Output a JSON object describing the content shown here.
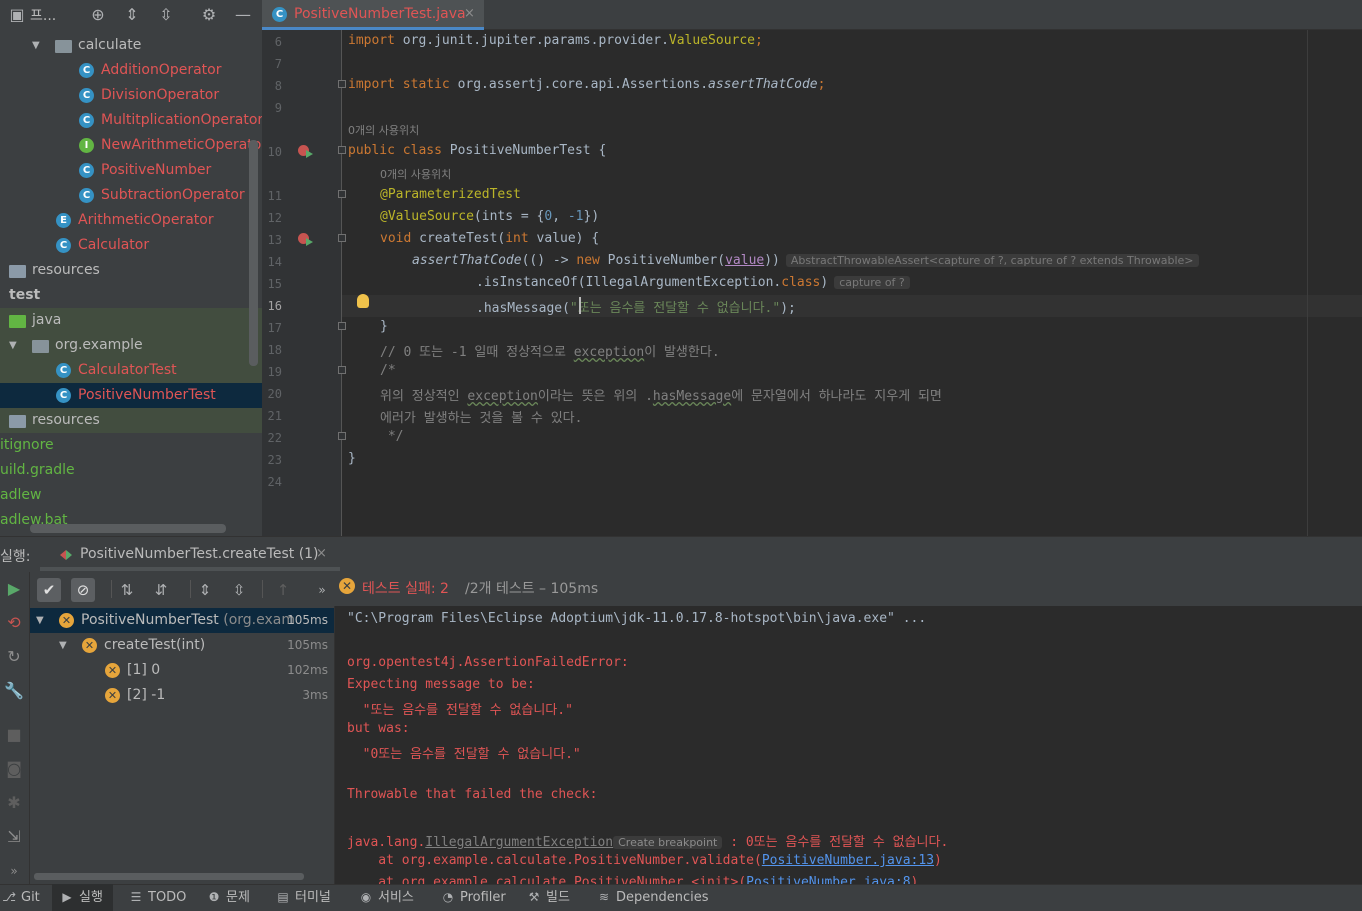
{
  "project": {
    "title": "프...",
    "tree": [
      {
        "label": "calculate",
        "kind": "package",
        "expanded": true,
        "color": "plain"
      },
      {
        "label": "AdditionOperator",
        "kind": "class",
        "color": "red"
      },
      {
        "label": "DivisionOperator",
        "kind": "class",
        "color": "red"
      },
      {
        "label": "MultitplicationOperator",
        "kind": "class",
        "color": "red"
      },
      {
        "label": "NewArithmeticOperator",
        "kind": "interface",
        "color": "red"
      },
      {
        "label": "PositiveNumber",
        "kind": "class",
        "color": "red"
      },
      {
        "label": "SubtractionOperator",
        "kind": "class",
        "color": "red"
      },
      {
        "label": "ArithmeticOperator",
        "kind": "enum",
        "color": "red"
      },
      {
        "label": "Calculator",
        "kind": "class",
        "color": "red"
      },
      {
        "label": "resources",
        "kind": "folder",
        "color": "plain"
      },
      {
        "label": "test",
        "kind": "folder",
        "color": "bold"
      },
      {
        "label": "java",
        "kind": "folder",
        "color": "plain"
      },
      {
        "label": "org.example",
        "kind": "package",
        "expanded": true,
        "color": "plain"
      },
      {
        "label": "CalculatorTest",
        "kind": "test-class",
        "color": "red"
      },
      {
        "label": "PositiveNumberTest",
        "kind": "test-class",
        "color": "red",
        "selected": true
      },
      {
        "label": "resources",
        "kind": "folder",
        "color": "plain"
      },
      {
        "label": "itignore",
        "kind": "file",
        "color": "green"
      },
      {
        "label": "uild.gradle",
        "kind": "file",
        "color": "green"
      },
      {
        "label": "adlew",
        "kind": "file",
        "color": "green"
      },
      {
        "label": "adlew.bat",
        "kind": "file",
        "color": "green"
      }
    ]
  },
  "editor": {
    "tab_label": "PositiveNumberTest.java",
    "tab_close": "×",
    "line_numbers": [
      "6",
      "7",
      "8",
      "9",
      "10",
      "11",
      "12",
      "13",
      "14",
      "15",
      "16",
      "17",
      "18",
      "19",
      "20",
      "21",
      "22",
      "23",
      "24"
    ],
    "usage_hint_1": "0개의 사용위치",
    "usage_hint_2": "0개의 사용위치",
    "code": {
      "l6_kw": "import",
      "l6_rest": " org.junit.jupiter.params.provider.",
      "l6_ann": "ValueSource",
      "l6_end": ";",
      "l8_kw": "import static",
      "l8_rest": " org.assertj.core.api.Assertions.",
      "l8_method": "assertThatCode",
      "l8_end": ";",
      "l10_kw": "public class",
      "l10_rest": " PositiveNumberTest {",
      "l11_ann": "@ParameterizedTest",
      "l12_ann": "@ValueSource",
      "l12_a": "(ints = {",
      "l12_n1": "0",
      "l12_b": ", ",
      "l12_n2": "-1",
      "l12_c": "})",
      "l13_kw": "void",
      "l13_a": " createTest(",
      "l13_kw2": "int",
      "l13_b": " value) {",
      "l14_method": "assertThatCode",
      "l14_a": "(() -> ",
      "l14_kw": "new",
      "l14_b": " PositiveNumber(",
      "l14_param": "value",
      "l14_c": "))",
      "l14_hint": "AbstractThrowableAssert<capture of ?, capture of ? extends Throwable>",
      "l15_a": ".isInstanceOf(IllegalArgumentException.",
      "l15_kw": "class",
      "l15_b": ")",
      "l15_hint": "capture of ?",
      "l16_a": ".hasMessage(",
      "l16_str": "\"또는 음수를 전달할 수 없습니다.\"",
      "l16_b": ");",
      "l17": "}",
      "l18_a": "// 0 또는 -1 일때 정상적으로 ",
      "l18_typo": "exception",
      "l18_b": "이 발생한다.",
      "l19": "/*",
      "l20_a": "위의 정상적인 ",
      "l20_typo1": "exception",
      "l20_b": "이라는 뜻은 위의 .",
      "l20_typo2": "hasMessage",
      "l20_c": "에 문자열에서 하나라도 지우게 되면",
      "l21": "에러가 발생하는 것을 볼 수 있다.",
      "l22": " */",
      "l23": "}"
    }
  },
  "run": {
    "title": "실행:",
    "tab_label": "PositiveNumberTest.createTest (1)",
    "tab_close": "×",
    "status_fail": "테스트 실패: 2",
    "status_rest": "/2개 테스트 – 105ms",
    "tree": [
      {
        "name": "PositiveNumberTest",
        "pkg": " (org.exam",
        "time": "105ms"
      },
      {
        "name": "createTest(int)",
        "time": "105ms"
      },
      {
        "name": "[1] 0",
        "time": "102ms"
      },
      {
        "name": "[2] -1",
        "time": "3ms"
      }
    ],
    "console": {
      "cmd": "\"C:\\Program Files\\Eclipse Adoptium\\jdk-11.0.17.8-hotspot\\bin\\java.exe\" ...",
      "err1": "org.opentest4j.AssertionFailedError:",
      "err2": "Expecting message to be:",
      "err3": "  \"또는 음수를 전달할 수 없습니다.\"",
      "err4": "but was:",
      "err5": "  \"0또는 음수를 전달할 수 없습니다.\"",
      "err6": "Throwable that failed the check:",
      "exc_prefix": "java.lang.",
      "exc_name": "IllegalArgumentException",
      "exc_bp": "Create breakpoint",
      "exc_msg": " : 0또는 음수를 전달할 수 없습니다.",
      "at1_prefix": "    at org.example.calculate.PositiveNumber.validate(",
      "at1_link": "PositiveNumber.java:13",
      "at1_end": ")",
      "at2_prefix": "    at org.example.calculate.PositiveNumber.<init>(",
      "at2_link": "PositiveNumber.java:8",
      "at2_end": ")"
    }
  },
  "bottom_bar": {
    "git": "Git",
    "run": "실행",
    "todo": "TODO",
    "problems": "문제",
    "terminal": "터미널",
    "services": "서비스",
    "profiler": "Profiler",
    "build": "빌드",
    "dependencies": "Dependencies"
  }
}
